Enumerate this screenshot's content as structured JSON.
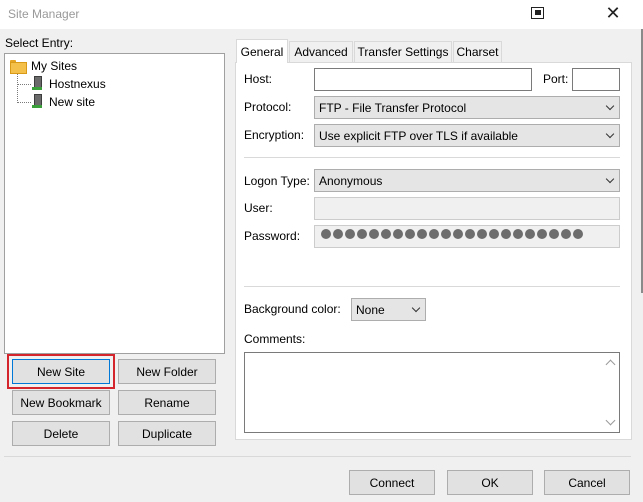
{
  "window": {
    "title": "Site Manager"
  },
  "left": {
    "select_entry_label": "Select Entry:",
    "tree": {
      "root": {
        "label": "My Sites",
        "icon": "folder-icon"
      },
      "children": [
        {
          "label": "Hostnexus",
          "icon": "site-icon"
        },
        {
          "label": "New site",
          "icon": "site-icon"
        }
      ]
    },
    "buttons": {
      "new_site": "New Site",
      "new_folder": "New Folder",
      "new_bookmark": "New Bookmark",
      "rename": "Rename",
      "delete": "Delete",
      "duplicate": "Duplicate"
    },
    "highlight_color": "#d4242c"
  },
  "tabs": [
    {
      "label": "General",
      "active": true
    },
    {
      "label": "Advanced"
    },
    {
      "label": "Transfer Settings"
    },
    {
      "label": "Charset"
    }
  ],
  "general": {
    "host_label": "Host:",
    "host_value": "",
    "port_label": "Port:",
    "port_value": "",
    "protocol_label": "Protocol:",
    "protocol_value": "FTP - File Transfer Protocol",
    "encryption_label": "Encryption:",
    "encryption_value": "Use explicit FTP over TLS if available",
    "logon_type_label": "Logon Type:",
    "logon_type_value": "Anonymous",
    "user_label": "User:",
    "user_value": "",
    "password_label": "Password:",
    "password_mask_count": 22,
    "background_color_label": "Background color:",
    "background_color_value": "None",
    "comments_label": "Comments:",
    "comments_value": ""
  },
  "footer": {
    "connect": "Connect",
    "ok": "OK",
    "cancel": "Cancel"
  }
}
